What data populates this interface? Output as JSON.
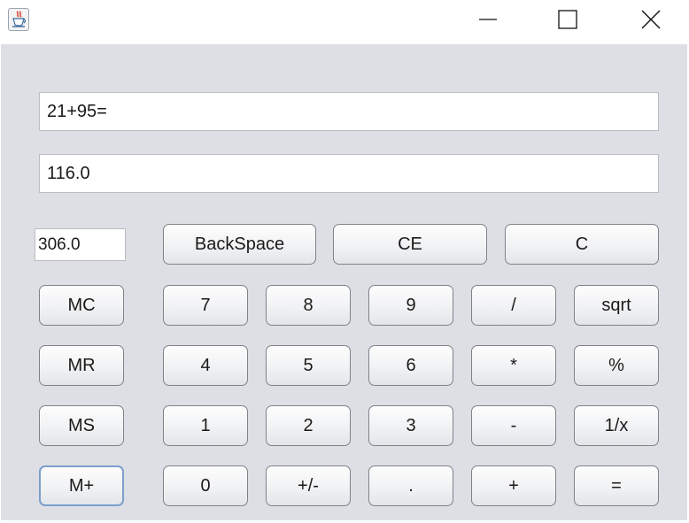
{
  "window": {
    "icon": "java-cup-icon",
    "controls": [
      "minimize-icon",
      "maximize-icon",
      "close-icon"
    ]
  },
  "display": {
    "expression": "21+95=",
    "result": "116.0",
    "memory": "306.0"
  },
  "buttons": {
    "backspace": "BackSpace",
    "ce": "CE",
    "c": "C",
    "mc": "MC",
    "mr": "MR",
    "ms": "MS",
    "mplus": "M+",
    "d7": "7",
    "d8": "8",
    "d9": "9",
    "d4": "4",
    "d5": "5",
    "d6": "6",
    "d1": "1",
    "d2": "2",
    "d3": "3",
    "d0": "0",
    "negate": "+/-",
    "dot": ".",
    "divide": "/",
    "multiply": "*",
    "subtract": "-",
    "add": "+",
    "sqrt": "sqrt",
    "percent": "%",
    "reciprocal": "1/x",
    "equals": "="
  }
}
